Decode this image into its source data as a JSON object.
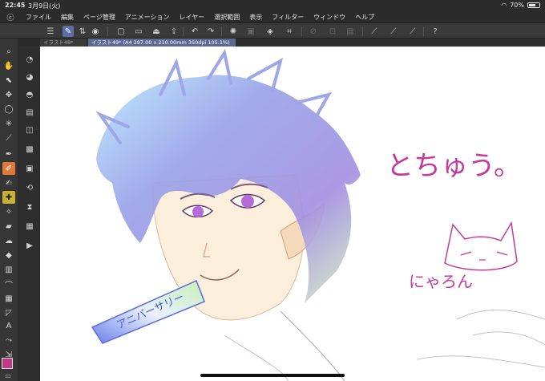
{
  "status_bar": {
    "time": "22:45",
    "date": "3月9日(火)",
    "battery": "70%",
    "battery_level": 0.7
  },
  "menu": {
    "items": [
      "ファイル",
      "編集",
      "ページ管理",
      "アニメーション",
      "レイヤー",
      "選択範囲",
      "表示",
      "フィルター",
      "ウィンドウ",
      "ヘルプ"
    ]
  },
  "tabs": [
    {
      "label": "イラスト48*"
    },
    {
      "label": "イラスト49* (A4 297.00 x 210.00mm 350dpi 105.1%)"
    }
  ],
  "artwork": {
    "ribbon_text": "アニバーサリー",
    "text_main": "とちゅう。",
    "text_cat": "にゃろん"
  },
  "colors": {
    "main_color": "#c2398a",
    "sub_color": "#9fc9e8",
    "hair": "#a9a6e6",
    "skin": "#fbeedb",
    "eye": "#b66bd8",
    "handwriting": "#c23a9c"
  }
}
